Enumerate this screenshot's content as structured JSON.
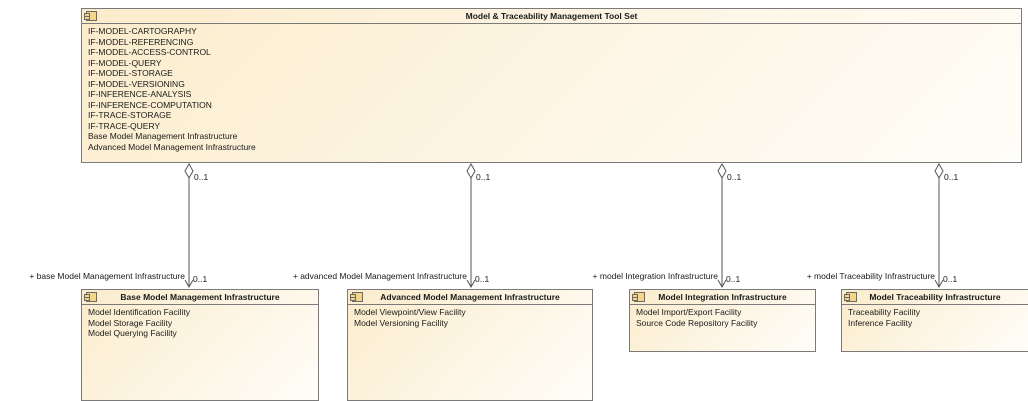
{
  "main": {
    "title": "Model & Traceability Management Tool Set",
    "items": [
      "IF-MODEL-CARTOGRAPHY",
      "IF-MODEL-REFERENCING",
      "IF-MODEL-ACCESS-CONTROL",
      "IF-MODEL-QUERY",
      "IF-MODEL-STORAGE",
      "IF-MODEL-VERSIONING",
      "IF-INFERENCE-ANALYSIS",
      "IF-INFERENCE-COMPUTATION",
      "IF-TRACE-STORAGE",
      "IF-TRACE-QUERY",
      "Base Model Management Infrastructure",
      "Advanced Model Management Infrastructure"
    ]
  },
  "components": [
    {
      "title": "Base Model Management Infrastructure",
      "items": [
        "Model Identification Facility",
        "Model Storage Facility",
        "Model Querying Facility"
      ],
      "role": "+ base Model Management Infrastructure",
      "source_mult": "0..1",
      "target_mult": "0..1"
    },
    {
      "title": "Advanced Model Management Infrastructure",
      "items": [
        "Model Viewpoint/View Facility",
        "Model Versioning Facility"
      ],
      "role": "+ advanced Model Management Infrastructure",
      "source_mult": "0..1",
      "target_mult": "0..1"
    },
    {
      "title": "Model Integration Infrastructure",
      "items": [
        "Model Import/Export Facility",
        "Source Code Repository Facility"
      ],
      "role": "+ model Integration Infrastructure",
      "source_mult": "0..1",
      "target_mult": "0..1"
    },
    {
      "title": "Model Traceability Infrastructure",
      "items": [
        "Traceability Facility",
        "Inference Facility"
      ],
      "role": "+ model Traceability Infrastructure",
      "source_mult": "0..1",
      "target_mult": "0..1"
    }
  ],
  "icons": {
    "component": "component-icon",
    "aggregation": "aggregation-diamond-icon"
  },
  "colors": {
    "box_fill": "#fdf3dc",
    "border": "#7a7a7a",
    "line": "#555555"
  }
}
